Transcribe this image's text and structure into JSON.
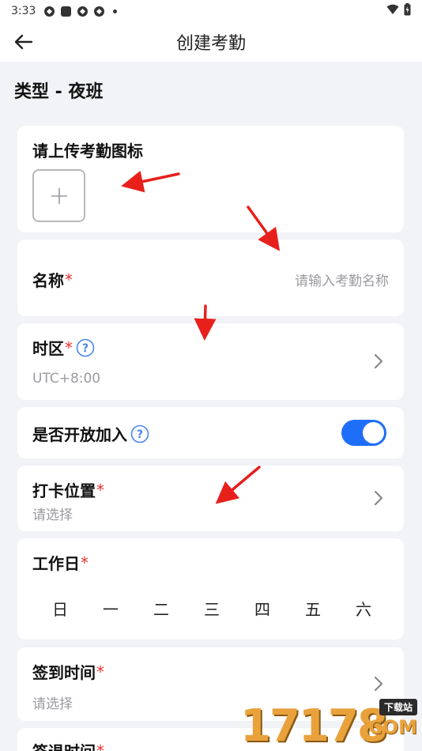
{
  "status_bar": {
    "time": "3:33"
  },
  "app_bar": {
    "title": "创建考勤"
  },
  "type_title": "类型 - 夜班",
  "upload": {
    "label": "请上传考勤图标"
  },
  "name": {
    "label": "名称",
    "required": "*",
    "placeholder": "请输入考勤名称"
  },
  "timezone": {
    "label": "时区",
    "required": "*",
    "value": "UTC+8:00"
  },
  "open_join": {
    "label": "是否开放加入",
    "enabled": true
  },
  "location": {
    "label": "打卡位置",
    "required": "*",
    "placeholder": "请选择"
  },
  "workdays": {
    "label": "工作日",
    "required": "*",
    "days": [
      "日",
      "一",
      "二",
      "三",
      "四",
      "五",
      "六"
    ]
  },
  "checkin": {
    "label": "签到时间",
    "required": "*",
    "placeholder": "请选择"
  },
  "checkout": {
    "label": "签退时间",
    "required": "*"
  },
  "watermark": {
    "number": "17178",
    "tag": "下载站",
    "suffix": "COM"
  },
  "colors": {
    "accent": "#1f6ef7",
    "required": "#e5322f",
    "annotation": "#e8201c"
  }
}
